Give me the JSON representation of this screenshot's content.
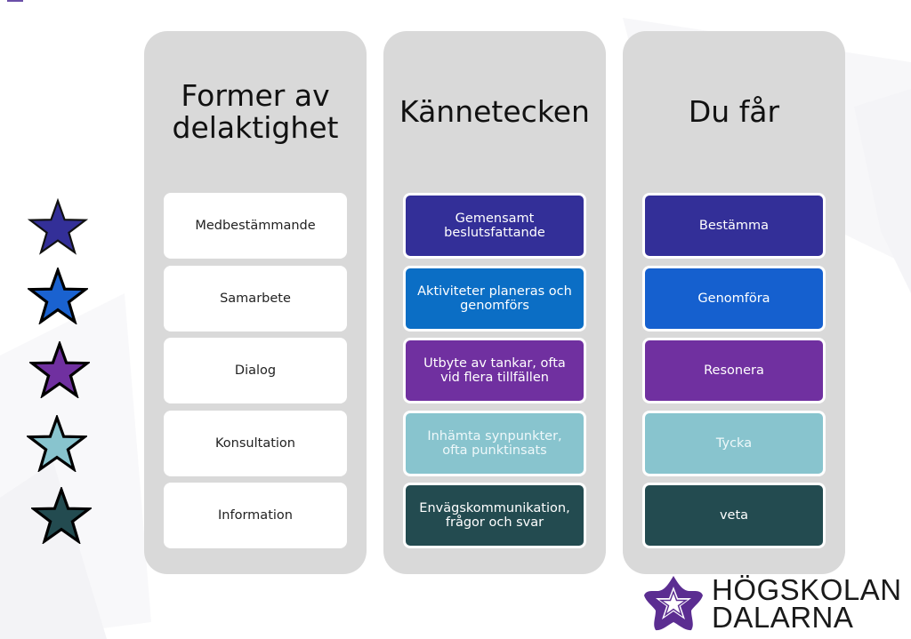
{
  "columns": [
    {
      "title": "Former av delaktighet",
      "items": [
        {
          "label": "Medbestämmande",
          "color": "#ffffff"
        },
        {
          "label": "Samarbete",
          "color": "#ffffff"
        },
        {
          "label": "Dialog",
          "color": "#ffffff"
        },
        {
          "label": "Konsultation",
          "color": "#ffffff"
        },
        {
          "label": "Information",
          "color": "#ffffff"
        }
      ]
    },
    {
      "title": "Kännetecken",
      "items": [
        {
          "label": "Gemensamt beslutsfattande",
          "color": "#332f98"
        },
        {
          "label": "Aktiviteter planeras och genomförs",
          "color": "#0b6ec5"
        },
        {
          "label": "Utbyte av tankar, ofta vid flera tillfällen",
          "color": "#7030a0"
        },
        {
          "label": "Inhämta synpunkter, ofta punktinsats",
          "color": "#88c4ce"
        },
        {
          "label": "Envägskommunikation, frågor och svar",
          "color": "#234b50"
        }
      ]
    },
    {
      "title": "Du får",
      "items": [
        {
          "label": "Bestämma",
          "color": "#332f98"
        },
        {
          "label": "Genomföra",
          "color": "#1560cf"
        },
        {
          "label": "Resonera",
          "color": "#7030a0"
        },
        {
          "label": "Tycka",
          "color": "#88c4ce"
        },
        {
          "label": "veta",
          "color": "#234b50"
        }
      ]
    }
  ],
  "stars": [
    {
      "icon": "star-icon",
      "color": "#332f98"
    },
    {
      "icon": "star-icon",
      "color": "#1a62d0"
    },
    {
      "icon": "star-icon",
      "color": "#7030a0"
    },
    {
      "icon": "star-icon",
      "color": "#88c4ce"
    },
    {
      "icon": "star-icon",
      "color": "#234b50"
    }
  ],
  "logo": {
    "line1": "HÖGSKOLAN",
    "line2": "DALARNA",
    "color": "#5b2d91"
  }
}
